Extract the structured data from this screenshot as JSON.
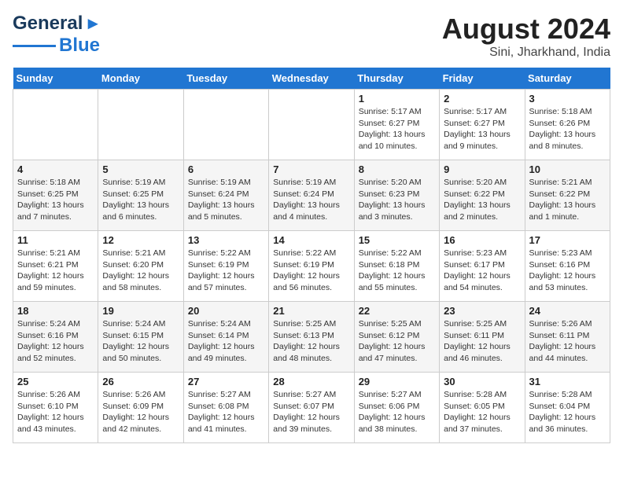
{
  "logo": {
    "line1": "General",
    "line2": "Blue",
    "arrow": "▶"
  },
  "title": "August 2024",
  "subtitle": "Sini, Jharkhand, India",
  "days_of_week": [
    "Sunday",
    "Monday",
    "Tuesday",
    "Wednesday",
    "Thursday",
    "Friday",
    "Saturday"
  ],
  "weeks": [
    [
      {
        "day": "",
        "info": ""
      },
      {
        "day": "",
        "info": ""
      },
      {
        "day": "",
        "info": ""
      },
      {
        "day": "",
        "info": ""
      },
      {
        "day": "1",
        "info": "Sunrise: 5:17 AM\nSunset: 6:27 PM\nDaylight: 13 hours\nand 10 minutes."
      },
      {
        "day": "2",
        "info": "Sunrise: 5:17 AM\nSunset: 6:27 PM\nDaylight: 13 hours\nand 9 minutes."
      },
      {
        "day": "3",
        "info": "Sunrise: 5:18 AM\nSunset: 6:26 PM\nDaylight: 13 hours\nand 8 minutes."
      }
    ],
    [
      {
        "day": "4",
        "info": "Sunrise: 5:18 AM\nSunset: 6:25 PM\nDaylight: 13 hours\nand 7 minutes."
      },
      {
        "day": "5",
        "info": "Sunrise: 5:19 AM\nSunset: 6:25 PM\nDaylight: 13 hours\nand 6 minutes."
      },
      {
        "day": "6",
        "info": "Sunrise: 5:19 AM\nSunset: 6:24 PM\nDaylight: 13 hours\nand 5 minutes."
      },
      {
        "day": "7",
        "info": "Sunrise: 5:19 AM\nSunset: 6:24 PM\nDaylight: 13 hours\nand 4 minutes."
      },
      {
        "day": "8",
        "info": "Sunrise: 5:20 AM\nSunset: 6:23 PM\nDaylight: 13 hours\nand 3 minutes."
      },
      {
        "day": "9",
        "info": "Sunrise: 5:20 AM\nSunset: 6:22 PM\nDaylight: 13 hours\nand 2 minutes."
      },
      {
        "day": "10",
        "info": "Sunrise: 5:21 AM\nSunset: 6:22 PM\nDaylight: 13 hours\nand 1 minute."
      }
    ],
    [
      {
        "day": "11",
        "info": "Sunrise: 5:21 AM\nSunset: 6:21 PM\nDaylight: 12 hours\nand 59 minutes."
      },
      {
        "day": "12",
        "info": "Sunrise: 5:21 AM\nSunset: 6:20 PM\nDaylight: 12 hours\nand 58 minutes."
      },
      {
        "day": "13",
        "info": "Sunrise: 5:22 AM\nSunset: 6:19 PM\nDaylight: 12 hours\nand 57 minutes."
      },
      {
        "day": "14",
        "info": "Sunrise: 5:22 AM\nSunset: 6:19 PM\nDaylight: 12 hours\nand 56 minutes."
      },
      {
        "day": "15",
        "info": "Sunrise: 5:22 AM\nSunset: 6:18 PM\nDaylight: 12 hours\nand 55 minutes."
      },
      {
        "day": "16",
        "info": "Sunrise: 5:23 AM\nSunset: 6:17 PM\nDaylight: 12 hours\nand 54 minutes."
      },
      {
        "day": "17",
        "info": "Sunrise: 5:23 AM\nSunset: 6:16 PM\nDaylight: 12 hours\nand 53 minutes."
      }
    ],
    [
      {
        "day": "18",
        "info": "Sunrise: 5:24 AM\nSunset: 6:16 PM\nDaylight: 12 hours\nand 52 minutes."
      },
      {
        "day": "19",
        "info": "Sunrise: 5:24 AM\nSunset: 6:15 PM\nDaylight: 12 hours\nand 50 minutes."
      },
      {
        "day": "20",
        "info": "Sunrise: 5:24 AM\nSunset: 6:14 PM\nDaylight: 12 hours\nand 49 minutes."
      },
      {
        "day": "21",
        "info": "Sunrise: 5:25 AM\nSunset: 6:13 PM\nDaylight: 12 hours\nand 48 minutes."
      },
      {
        "day": "22",
        "info": "Sunrise: 5:25 AM\nSunset: 6:12 PM\nDaylight: 12 hours\nand 47 minutes."
      },
      {
        "day": "23",
        "info": "Sunrise: 5:25 AM\nSunset: 6:11 PM\nDaylight: 12 hours\nand 46 minutes."
      },
      {
        "day": "24",
        "info": "Sunrise: 5:26 AM\nSunset: 6:11 PM\nDaylight: 12 hours\nand 44 minutes."
      }
    ],
    [
      {
        "day": "25",
        "info": "Sunrise: 5:26 AM\nSunset: 6:10 PM\nDaylight: 12 hours\nand 43 minutes."
      },
      {
        "day": "26",
        "info": "Sunrise: 5:26 AM\nSunset: 6:09 PM\nDaylight: 12 hours\nand 42 minutes."
      },
      {
        "day": "27",
        "info": "Sunrise: 5:27 AM\nSunset: 6:08 PM\nDaylight: 12 hours\nand 41 minutes."
      },
      {
        "day": "28",
        "info": "Sunrise: 5:27 AM\nSunset: 6:07 PM\nDaylight: 12 hours\nand 39 minutes."
      },
      {
        "day": "29",
        "info": "Sunrise: 5:27 AM\nSunset: 6:06 PM\nDaylight: 12 hours\nand 38 minutes."
      },
      {
        "day": "30",
        "info": "Sunrise: 5:28 AM\nSunset: 6:05 PM\nDaylight: 12 hours\nand 37 minutes."
      },
      {
        "day": "31",
        "info": "Sunrise: 5:28 AM\nSunset: 6:04 PM\nDaylight: 12 hours\nand 36 minutes."
      }
    ]
  ]
}
